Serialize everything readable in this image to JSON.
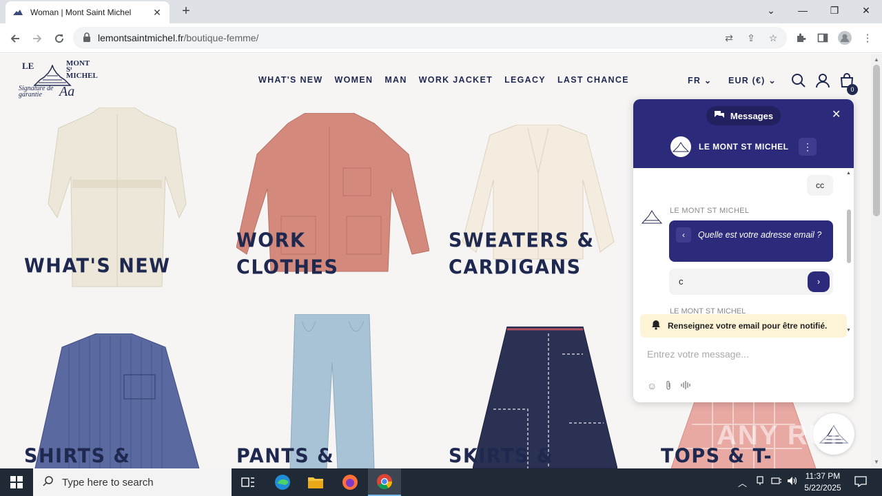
{
  "browser": {
    "tab_title": "Woman | Mont Saint Michel",
    "url_host": "lemontsaintmichel.fr",
    "url_path": "/boutique-femme/"
  },
  "site": {
    "logo_line1": "LE",
    "logo_line2": "MONT Sᵗ MICHEL",
    "logo_line3": "Signature de garantie",
    "logo_mark": "Aa",
    "nav": [
      "WHAT'S NEW",
      "WOMEN",
      "MAN",
      "WORK JACKET",
      "LEGACY",
      "LAST CHANCE"
    ],
    "lang": "FR",
    "currency": "EUR (€)",
    "cart_count": "0"
  },
  "categories": [
    {
      "label_1": "WHAT'S NEW",
      "label_2": ""
    },
    {
      "label_1": "WORK",
      "label_2": "CLOTHES"
    },
    {
      "label_1": "SWEATERS &",
      "label_2": "CARDIGANS"
    },
    {
      "label_1": "SHIRTS &",
      "label_2": ""
    },
    {
      "label_1": "PANTS &",
      "label_2": ""
    },
    {
      "label_1": "SKIRTS &",
      "label_2": ""
    },
    {
      "label_1": "TOPS & T-",
      "label_2": ""
    }
  ],
  "chat": {
    "messages_label": "Messages",
    "brand_name": "LE MONT ST MICHEL",
    "user_message": "cc",
    "bot_name": "LE MONT ST MICHEL",
    "bot_question": "Quelle est votre adresse email ?",
    "reply_value": "c",
    "notify_text": "Renseignez votre email pour être notifié.",
    "input_placeholder": "Entrez votre message..."
  },
  "taskbar": {
    "search_placeholder": "Type here to search",
    "time": "11:37 PM",
    "date": "5/22/2025"
  },
  "watermark": "ANY RUN",
  "colors": {
    "brand_navy": "#1f2950",
    "chat_purple": "#2c2a7a",
    "notify_bg": "#fdf4d7"
  }
}
